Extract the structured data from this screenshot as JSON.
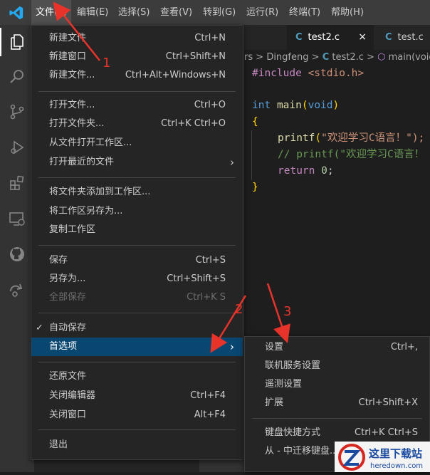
{
  "menubar": {
    "items": [
      {
        "label": "文件(F)",
        "active": true
      },
      {
        "label": "编辑(E)"
      },
      {
        "label": "选择(S)"
      },
      {
        "label": "查看(V)"
      },
      {
        "label": "转到(G)"
      },
      {
        "label": "运行(R)"
      },
      {
        "label": "终端(T)"
      },
      {
        "label": "帮助(H)"
      }
    ]
  },
  "activity_icons": [
    "files-icon",
    "search-icon",
    "source-control-icon",
    "run-debug-icon",
    "extensions-icon",
    "remote-explorer-icon",
    "github-icon",
    "live-share-icon"
  ],
  "tabs": [
    {
      "label": "test2.c",
      "close": "×",
      "icon": "C"
    },
    {
      "label": "test.c",
      "icon": "C"
    }
  ],
  "breadcrumb": {
    "path1": "rs",
    "sep": ">",
    "path2": "Dingfeng",
    "file_icon": "C",
    "file": "test2.c",
    "symbol": "main(void)"
  },
  "code": {
    "include_kw": "#include",
    "include_file": "<stdio.h>",
    "int_kw": "int",
    "main_fn": "main",
    "void_kw": "void",
    "open_brace": "{",
    "printf1": "printf",
    "str1": "\"欢迎学习C语言！\");",
    "comment": "// printf(\"欢迎学习C语言！",
    "return_kw": "return",
    "zero": "0",
    "close_brace": "}"
  },
  "file_menu": {
    "groups": [
      [
        {
          "label": "新建文件",
          "kb": "Ctrl+N"
        },
        {
          "label": "新建窗口",
          "kb": "Ctrl+Shift+N"
        },
        {
          "label": "新建文件...",
          "kb": "Ctrl+Alt+Windows+N"
        }
      ],
      [
        {
          "label": "打开文件...",
          "kb": "Ctrl+O"
        },
        {
          "label": "打开文件夹...",
          "kb": "Ctrl+K Ctrl+O"
        },
        {
          "label": "从文件打开工作区..."
        },
        {
          "label": "打开最近的文件",
          "arrow": "›"
        }
      ],
      [
        {
          "label": "将文件夹添加到工作区..."
        },
        {
          "label": "将工作区另存为..."
        },
        {
          "label": "复制工作区"
        }
      ],
      [
        {
          "label": "保存",
          "kb": "Ctrl+S"
        },
        {
          "label": "另存为...",
          "kb": "Ctrl+Shift+S"
        },
        {
          "label": "全部保存",
          "kb": "Ctrl+K S",
          "disabled": true
        }
      ],
      [
        {
          "label": "自动保存",
          "check": "✓"
        },
        {
          "label": "首选项",
          "arrow": "›",
          "highlight": true
        }
      ],
      [
        {
          "label": "还原文件"
        },
        {
          "label": "关闭编辑器",
          "kb": "Ctrl+F4"
        },
        {
          "label": "关闭窗口",
          "kb": "Alt+F4"
        }
      ],
      [
        {
          "label": "退出"
        }
      ]
    ]
  },
  "prefs_submenu": {
    "items": [
      {
        "label": "设置",
        "kb": "Ctrl+,"
      },
      {
        "label": "联机服务设置"
      },
      {
        "label": "遥测设置"
      },
      {
        "label": "扩展",
        "kb": "Ctrl+Shift+X"
      },
      {
        "label": "键盘快捷方式",
        "kb": "Ctrl+K Ctrl+S"
      },
      {
        "label": "从 - 中迁移键盘..."
      }
    ]
  },
  "annotations": {
    "n1": "1",
    "n2": "2",
    "n3": "3"
  },
  "watermark": {
    "title": "这里下载站",
    "url": "heredown.com"
  },
  "colors": {
    "accent": "#007acc",
    "highlight": "#094771",
    "arrow_red": "#e8332a"
  }
}
